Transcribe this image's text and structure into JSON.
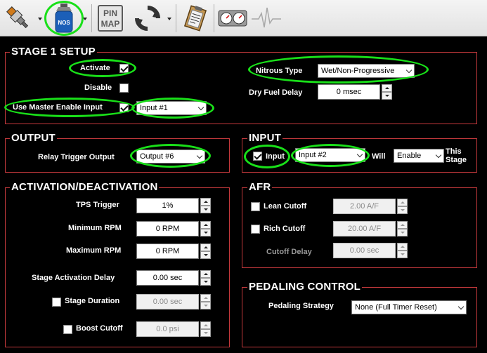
{
  "toolbar": {
    "pinmap_line1": "PIN",
    "pinmap_line2": "MAP",
    "nos_text": "NOS"
  },
  "stage1": {
    "title": "STAGE 1 SETUP",
    "activate_label": "Activate",
    "activate_checked": true,
    "disable_label": "Disable",
    "disable_checked": false,
    "use_master_label": "Use Master Enable Input",
    "use_master_checked": true,
    "master_input_value": "Input #1",
    "nitrous_type_label": "Nitrous Type",
    "nitrous_type_value": "Wet/Non-Progressive",
    "dry_fuel_delay_label": "Dry Fuel Delay",
    "dry_fuel_delay_value": "0 msec"
  },
  "output": {
    "title": "OUTPUT",
    "relay_label": "Relay Trigger Output",
    "relay_value": "Output #6"
  },
  "input": {
    "title": "INPUT",
    "input_label": "Input",
    "input_checked": true,
    "input_value": "Input #2",
    "will_label": "Will",
    "will_value": "Enable",
    "this_stage_line1": "This",
    "this_stage_line2": "Stage"
  },
  "activation": {
    "title": "ACTIVATION/DEACTIVATION",
    "tps_label": "TPS Trigger",
    "tps_value": "1%",
    "min_rpm_label": "Minimum RPM",
    "min_rpm_value": "0 RPM",
    "max_rpm_label": "Maximum RPM",
    "max_rpm_value": "0 RPM",
    "stage_delay_label": "Stage Activation Delay",
    "stage_delay_value": "0.00 sec",
    "stage_duration_label": "Stage Duration",
    "stage_duration_checked": false,
    "stage_duration_value": "0.00 sec",
    "boost_cutoff_label": "Boost Cutoff",
    "boost_cutoff_checked": false,
    "boost_cutoff_value": "0.0 psi"
  },
  "afr": {
    "title": "AFR",
    "lean_label": "Lean Cutoff",
    "lean_checked": false,
    "lean_value": "2.00 A/F",
    "rich_label": "Rich Cutoff",
    "rich_checked": false,
    "rich_value": "20.00 A/F",
    "cutoff_delay_label": "Cutoff Delay",
    "cutoff_delay_value": "0.00 sec"
  },
  "pedaling": {
    "title": "PEDALING CONTROL",
    "strategy_label": "Pedaling Strategy",
    "strategy_value": "None (Full Timer Reset)"
  },
  "colors": {
    "panel_border": "#c4393c",
    "highlight": "#19e019",
    "background": "#000000"
  },
  "icons": [
    "injector-icon",
    "nos-bottle-icon",
    "pin-map-icon",
    "refresh-icon",
    "clipboard-icon",
    "gauges-icon",
    "waveform-icon"
  ]
}
